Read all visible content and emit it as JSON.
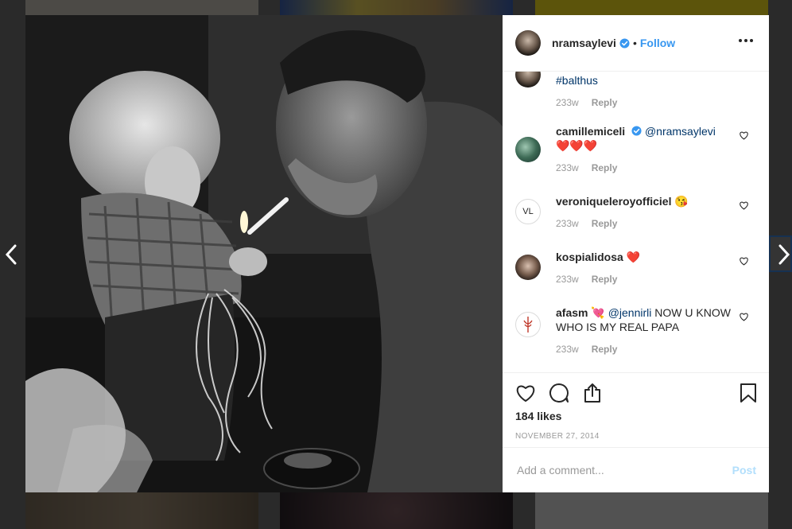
{
  "post": {
    "username": "nramsaylevi",
    "separator": "•",
    "follow_label": "Follow"
  },
  "comments": [
    {
      "username": "",
      "text": "#balthus",
      "time": "233w",
      "reply": "Reply"
    },
    {
      "username": "camillemiceli",
      "mention": "@nramsaylevi",
      "text": "❤️❤️❤️",
      "time": "233w",
      "reply": "Reply"
    },
    {
      "username": "veroniqueleroyofficiel",
      "text": "😘",
      "avatar_text": "VL",
      "time": "233w",
      "reply": "Reply"
    },
    {
      "username": "kospialidosa",
      "text": "❤️",
      "time": "233w",
      "reply": "Reply"
    },
    {
      "username": "afasm",
      "emoji": "💘",
      "mention": "@jennirli",
      "text": "NOW U KNOW WHO IS MY REAL PAPA",
      "time": "233w",
      "reply": "Reply"
    }
  ],
  "footer": {
    "likes": "184 likes",
    "date": "NOVEMBER 27, 2014",
    "comment_placeholder": "Add a comment...",
    "post_label": "Post"
  },
  "icons": {
    "like": "heart-outline-icon",
    "comment": "speech-bubble-icon",
    "share": "share-icon",
    "save": "bookmark-icon",
    "more": "more-horizontal-icon",
    "prev": "chevron-left-icon",
    "next": "chevron-right-icon",
    "verified": "verified-badge-icon"
  },
  "colors": {
    "link_blue": "#3897f0",
    "mention_blue": "#003569",
    "text": "#262626",
    "muted": "#999999",
    "post_disabled": "#b2dffc",
    "heart_red": "#ed4956"
  }
}
